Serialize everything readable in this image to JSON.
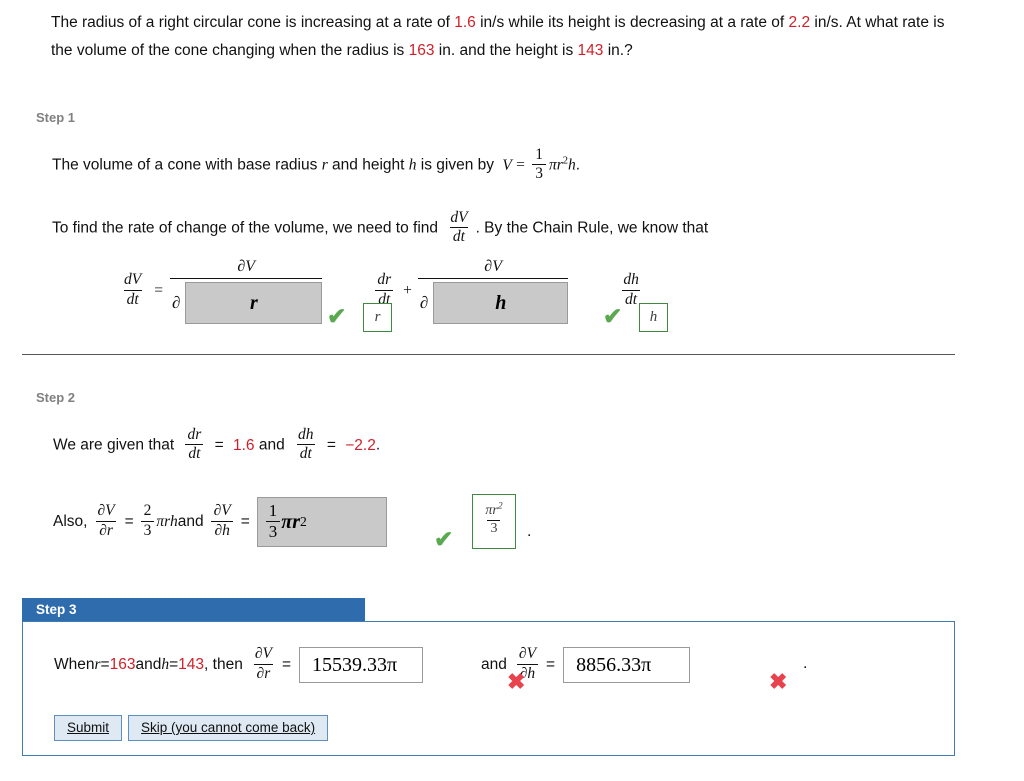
{
  "problem": {
    "part1": "The radius of a right circular cone is increasing at a rate of ",
    "rate_radius": "1.6",
    "part2": " in/s while its height is decreasing at a rate of ",
    "rate_height": "2.2",
    "part3": " in/s. At what rate is the volume of the cone changing when the radius is ",
    "radius": "163",
    "part4": " in. and the height is ",
    "height": "143",
    "part5": " in.?"
  },
  "step1": {
    "label": "Step 1",
    "line1_pre": "The volume of a cone with base radius ",
    "line1_r": "r",
    "line1_mid": " and height ",
    "line1_h": "h",
    "line1_post": " is given by ",
    "volume_V": "V",
    "volume_eq": "=",
    "volume_num": "1",
    "volume_den": "3",
    "volume_pi": "π",
    "volume_r": "r",
    "volume_exp": "2",
    "volume_h": "h",
    "volume_period": ".",
    "line2_pre": "To find the rate of change of the volume, we need to find ",
    "line2_frac_num": "dV",
    "line2_frac_den": "dt",
    "line2_post": ". By the Chain Rule, we know that",
    "chain": {
      "lhs_num": "dV",
      "lhs_den": "dt",
      "equals": "=",
      "term1_num": "∂V",
      "term1_partial": "∂",
      "term1_box_value": "r",
      "term1_tick": "✔",
      "term1_solution": "r",
      "term1_mult_num": "dr",
      "term1_mult_den": "dt",
      "plus": "+",
      "term2_num": "∂V",
      "term2_partial": "∂",
      "term2_box_value": "h",
      "term2_tick": "✔",
      "term2_solution": "h",
      "term2_mult_num": "dh",
      "term2_mult_den": "dt",
      "period": "."
    }
  },
  "step2": {
    "label": "Step 2",
    "given_pre": "We are given that ",
    "dr_num": "dr",
    "dr_den": "dt",
    "eq1": "=",
    "dr_value": "1.6",
    "and1": " and ",
    "dh_num": "dh",
    "dh_den": "dt",
    "eq2": "=",
    "dh_value": "−2.2",
    "period1": ".",
    "also_pre": "Also, ",
    "pv_pr_num": "∂V",
    "pv_pr_den": "∂r",
    "eq3": "=",
    "dvdr_num": "2",
    "dvdr_den": "3",
    "dvdr_rest": "πrh",
    "and2": " and ",
    "pv_ph_num": "∂V",
    "pv_ph_den": "∂h",
    "eq4": "=",
    "box_num": "1",
    "box_den": "3",
    "box_pi": "π",
    "box_r": "r",
    "box_exp": "2",
    "tick": "✔",
    "solution_num_pi": "π",
    "solution_num_r": "r",
    "solution_num_exp": "2",
    "solution_den": "3",
    "period2": "."
  },
  "step3": {
    "label": "Step 3",
    "when_pre": "When ",
    "r_sym": "r",
    "eq_r": " = ",
    "r_value": "163",
    "and_mid": " and ",
    "h_sym": "h",
    "eq_h": " = ",
    "h_value": "143",
    "then": ", then ",
    "pv_pr_num": "∂V",
    "pv_pr_den": "∂r",
    "eq1": "=",
    "answer_dvdr": "15539.33π",
    "cross1": "✖",
    "and_word": "and",
    "pv_ph_num": "∂V",
    "pv_ph_den": "∂h",
    "eq2": "=",
    "answer_dvdh": "8856.33π",
    "cross2": "✖",
    "period": "."
  },
  "buttons": {
    "submit": "Submit",
    "skip": "Skip (you cannot come back)"
  },
  "colors": {
    "accent_blue": "#2f6cad",
    "panel_border": "#3f7cb4",
    "value_red": "#d0212a",
    "correct_green": "#5aa84f",
    "incorrect_red": "#e8424c",
    "answer_box_fill": "#c9c9c9",
    "step_label_gray": "#808080",
    "button_fill": "#dfe9f3"
  }
}
